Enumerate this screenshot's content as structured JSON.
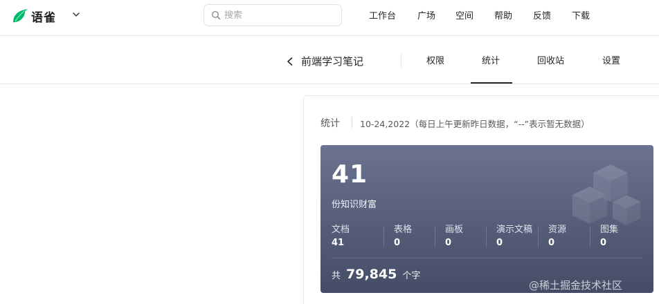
{
  "app": {
    "name": "语雀",
    "brand_color": "#00b96b"
  },
  "search": {
    "placeholder": "搜索"
  },
  "topnav": [
    {
      "label": "工作台"
    },
    {
      "label": "广场"
    },
    {
      "label": "空间"
    },
    {
      "label": "帮助"
    },
    {
      "label": "反馈"
    },
    {
      "label": "下载"
    }
  ],
  "book": {
    "title": "前端学习笔记"
  },
  "subtabs": [
    {
      "label": "权限",
      "active": false
    },
    {
      "label": "统计",
      "active": true
    },
    {
      "label": "回收站",
      "active": false
    },
    {
      "label": "设置",
      "active": false
    }
  ],
  "stats": {
    "title": "统计",
    "description": "10-24,2022（每日上午更新昨日数据，“--”表示暂无数据）",
    "knowledge_count": "41",
    "knowledge_label": "份知识财富",
    "metrics": [
      {
        "label": "文档",
        "value": "41"
      },
      {
        "label": "表格",
        "value": "0"
      },
      {
        "label": "画板",
        "value": "0"
      },
      {
        "label": "演示文稿",
        "value": "0"
      },
      {
        "label": "资源",
        "value": "0"
      },
      {
        "label": "图集",
        "value": "0"
      }
    ],
    "total_prefix": "共",
    "total_words": "79,845",
    "total_suffix": "个字",
    "panel_color": "#575f7b"
  },
  "watermark": "@稀土掘金技术社区"
}
